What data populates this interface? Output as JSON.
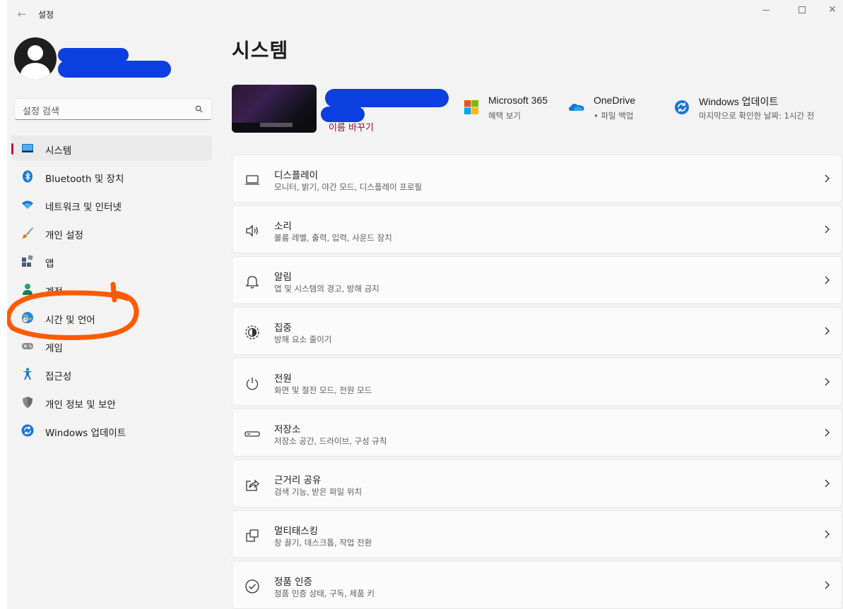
{
  "window": {
    "title": "설정",
    "back_glyph": "←",
    "close_glyph": "✕"
  },
  "search": {
    "placeholder": "설정 검색"
  },
  "sidebar": {
    "items": [
      {
        "label": "시스템",
        "icon": "monitor-icon",
        "active": true
      },
      {
        "label": "Bluetooth 및 장치",
        "icon": "bluetooth-icon"
      },
      {
        "label": "네트워크 및 인터넷",
        "icon": "wifi-icon"
      },
      {
        "label": "개인 설정",
        "icon": "brush-icon"
      },
      {
        "label": "앱",
        "icon": "apps-icon"
      },
      {
        "label": "계정",
        "icon": "account-icon"
      },
      {
        "label": "시간 및 언어",
        "icon": "globe-clock-icon"
      },
      {
        "label": "게임",
        "icon": "gamepad-icon"
      },
      {
        "label": "접근성",
        "icon": "accessibility-icon"
      },
      {
        "label": "개인 정보 및 보안",
        "icon": "shield-icon"
      },
      {
        "label": "Windows 업데이트",
        "icon": "update-icon"
      }
    ]
  },
  "main": {
    "title": "시스템",
    "rename_label": "이름 바꾸기",
    "quick": [
      {
        "title": "Microsoft 365",
        "sub": "혜택 보기",
        "icon": "microsoft-logo-icon"
      },
      {
        "title": "OneDrive",
        "sub": "• 파일 백업",
        "icon": "onedrive-cloud-icon"
      },
      {
        "title": "Windows 업데이트",
        "sub": "마지막으로 확인한 날짜: 1시간 전",
        "icon": "update-icon"
      }
    ],
    "settings": [
      {
        "title": "디스플레이",
        "sub": "모니터, 밝기, 야간 모드, 디스플레이 프로필",
        "icon": "display-icon"
      },
      {
        "title": "소리",
        "sub": "볼륨 레벨, 출력, 입력, 사운드 장치",
        "icon": "speaker-icon"
      },
      {
        "title": "알림",
        "sub": "앱 및 시스템의 경고, 방해 금지",
        "icon": "bell-icon"
      },
      {
        "title": "집중",
        "sub": "방해 요소 줄이기",
        "icon": "focus-icon"
      },
      {
        "title": "전원",
        "sub": "화면 및 절전 모드, 전원 모드",
        "icon": "power-icon"
      },
      {
        "title": "저장소",
        "sub": "저장소 공간, 드라이브, 구성 규칙",
        "icon": "storage-icon"
      },
      {
        "title": "근거리 공유",
        "sub": "검색 기능, 받은 파일 위치",
        "icon": "share-icon"
      },
      {
        "title": "멀티태스킹",
        "sub": "창 끌기, 데스크톱, 작업 전환",
        "icon": "multitask-icon"
      },
      {
        "title": "정품 인증",
        "sub": "정품 인증 상태, 구독, 제품 키",
        "icon": "check-circle-icon"
      }
    ]
  },
  "colors": {
    "accent": "#b0134a",
    "redaction": "#0b3fe0",
    "annotation": "#ff5a00"
  }
}
